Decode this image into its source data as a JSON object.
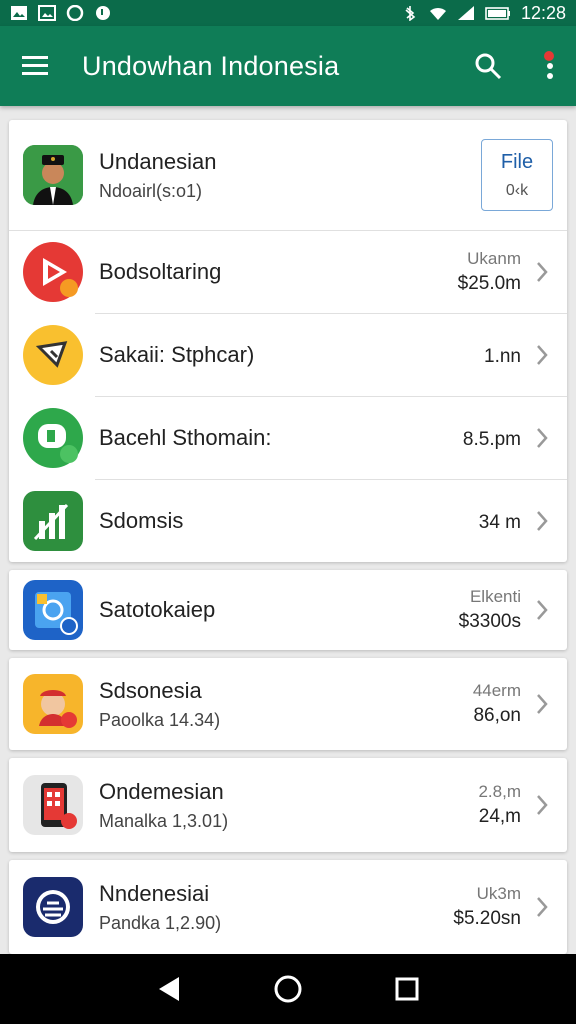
{
  "status": {
    "time": "12:28"
  },
  "appbar": {
    "title": "Undowhan Indonesia",
    "menu_icon": "menu-icon",
    "search_icon": "search-icon",
    "more_icon": "more-vert-icon",
    "badge_color": "#e53935"
  },
  "header_card": {
    "title": "Undanesian",
    "subtitle": "Ndoairl(s:o1)",
    "button_label": "File",
    "button_sub": "0‹k"
  },
  "group1": [
    {
      "title": "Bodsoltaring",
      "meta_top": "Ukanm",
      "meta_bottom": "$25.0m",
      "icon": "play-icon",
      "color": "#e53935"
    },
    {
      "title": "Sakaii: Stphcar)",
      "meta_top": "",
      "meta_bottom": "1.nn",
      "icon": "audio-icon",
      "color": "#f9c02f"
    },
    {
      "title": "Bacehl Sthomain:",
      "meta_top": "",
      "meta_bottom": "8.5.pm",
      "icon": "chat-icon",
      "color": "#2ea84b"
    },
    {
      "title": "Sdomsis",
      "meta_top": "",
      "meta_bottom": "34 m",
      "icon": "chart-icon",
      "color": "#2e8f3e"
    }
  ],
  "group2": {
    "title": "Satotokaiep",
    "meta_top": "Elkenti",
    "meta_bottom": "$3300s",
    "icon": "photo-icon",
    "color": "#1e63c7"
  },
  "group3": {
    "title": "Sdsonesia",
    "subtitle": "Paoolka 14.34)",
    "meta_top": "44erm",
    "meta_bottom": "86,on",
    "icon": "avatar-icon",
    "color": "#f7b52b"
  },
  "group4": {
    "title": "Ondemesian",
    "subtitle": "Manalka 1,3.01)",
    "meta_top": "2.8,m",
    "meta_bottom": "24,m",
    "icon": "phone-icon",
    "color": "#e6e6e6"
  },
  "group5": {
    "title": "Nndenesiai",
    "subtitle": "Pandka 1,2.90)",
    "meta_top": "Uk3m",
    "meta_bottom": "$5.20sn",
    "icon": "emblem-icon",
    "color": "#1a2b6d"
  }
}
